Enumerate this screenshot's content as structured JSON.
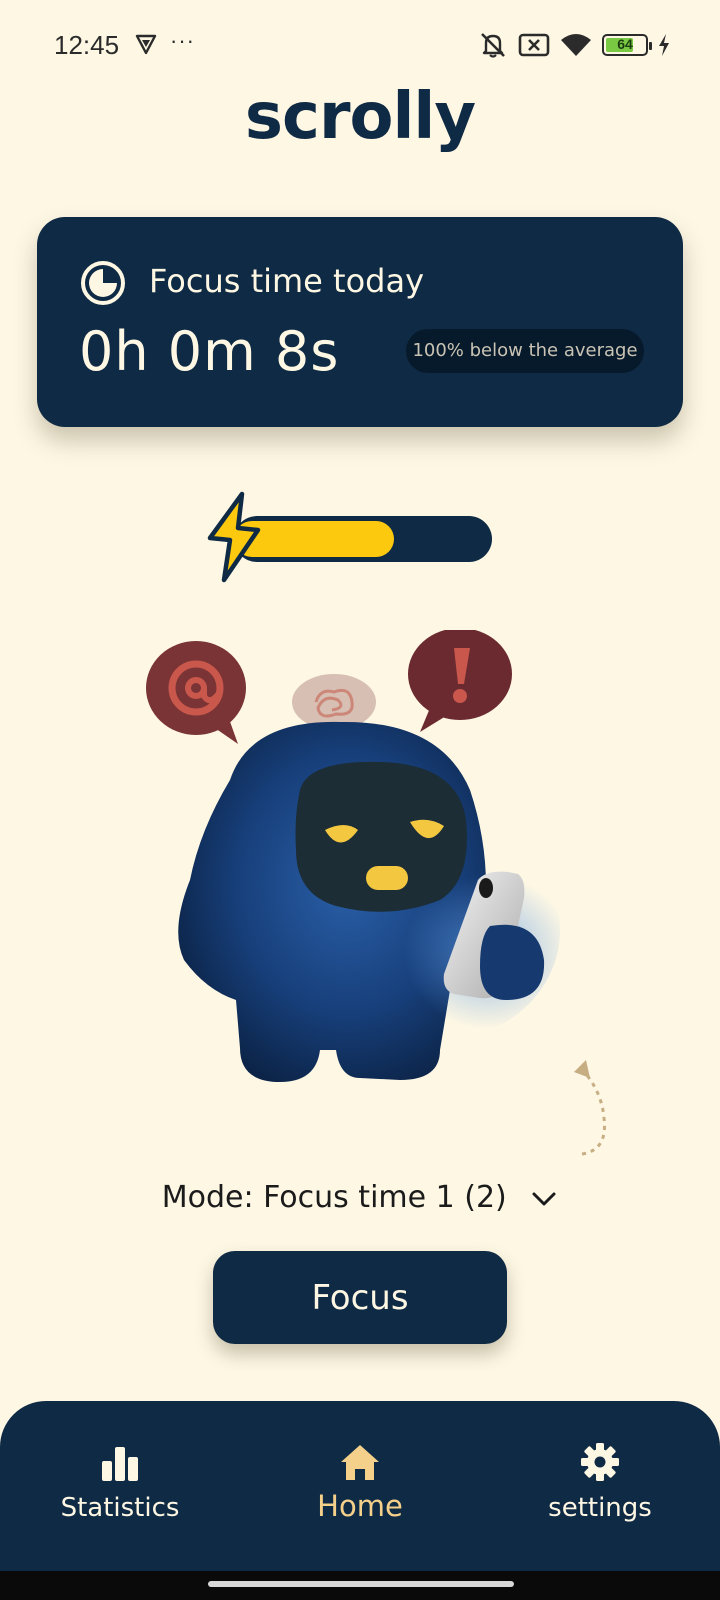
{
  "status_bar": {
    "time": "12:45",
    "dots": "···",
    "battery_level": "64",
    "icons": [
      "vpn-icon",
      "mute-icon",
      "no-sim-icon",
      "wifi-icon",
      "battery-icon",
      "charging-icon"
    ]
  },
  "app": {
    "title": "scrolly"
  },
  "focus_card": {
    "label": "Focus time today",
    "time": "0h 0m 8s",
    "comparison": "100% below the average",
    "icon": "timer-icon"
  },
  "energy": {
    "level_fraction": 0.62,
    "icon": "lightning-bolt-icon",
    "fill_color": "#fdc90f"
  },
  "mascot": {
    "icon": "mascot-robot-with-phone",
    "bubbles": [
      "at-sign-bubble",
      "tangled-thought-bubble",
      "exclamation-bubble"
    ]
  },
  "mode": {
    "label": "Mode: Focus time 1 (2)",
    "icon": "chevron-down-icon"
  },
  "focus_button": {
    "label": "Focus"
  },
  "bottom_nav": {
    "items": [
      {
        "label": "Statistics",
        "icon": "bar-chart-icon",
        "active": false
      },
      {
        "label": "Home",
        "icon": "home-icon",
        "active": true
      },
      {
        "label": "settings",
        "icon": "gear-icon",
        "active": false
      }
    ]
  },
  "colors": {
    "background": "#fdf7e4",
    "primary": "#0f2a44",
    "accent_yellow": "#fdc90f",
    "active_nav": "#f5d08a"
  }
}
